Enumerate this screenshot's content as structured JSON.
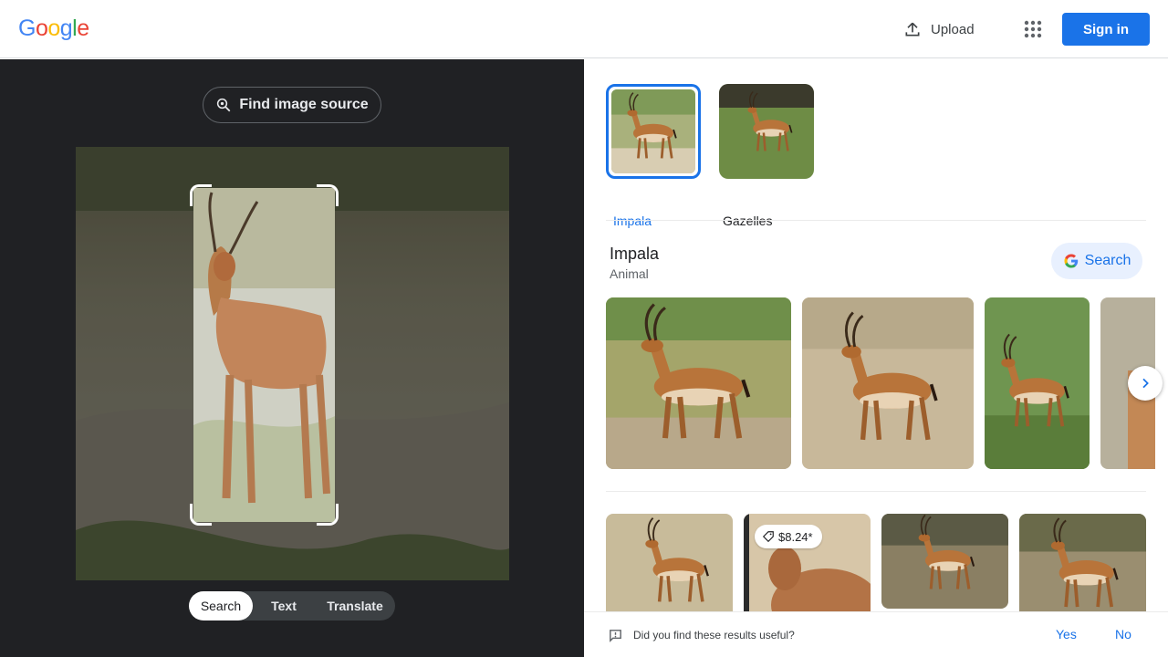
{
  "header": {
    "logo_letters": [
      {
        "ch": "G",
        "color": "#4285F4"
      },
      {
        "ch": "o",
        "color": "#EA4335"
      },
      {
        "ch": "o",
        "color": "#FBBC05"
      },
      {
        "ch": "g",
        "color": "#4285F4"
      },
      {
        "ch": "l",
        "color": "#34A853"
      },
      {
        "ch": "e",
        "color": "#EA4335"
      }
    ],
    "upload_label": "Upload",
    "upload_icon": "upload-icon",
    "apps_icon": "apps-grid-icon",
    "signin_label": "Sign in"
  },
  "left_panel": {
    "find_source_label": "Find image source",
    "find_source_icon": "lens-search-icon",
    "modes": [
      {
        "label": "Search",
        "active": true
      },
      {
        "label": "Text",
        "active": false
      },
      {
        "label": "Translate",
        "active": false
      }
    ]
  },
  "right_panel": {
    "chips": [
      {
        "label": "Impala",
        "selected": true
      },
      {
        "label": "Gazelles",
        "selected": false
      }
    ],
    "entity": {
      "title": "Impala",
      "subtitle": "Animal",
      "search_label": "Search"
    },
    "price_tag": "$8.24*",
    "feedback": {
      "question": "Did you find these results useful?",
      "yes": "Yes",
      "no": "No"
    }
  },
  "colors": {
    "accent": "#1a73e8",
    "dark_panel": "#202124",
    "selected_chip_border": "#1a73e8"
  }
}
